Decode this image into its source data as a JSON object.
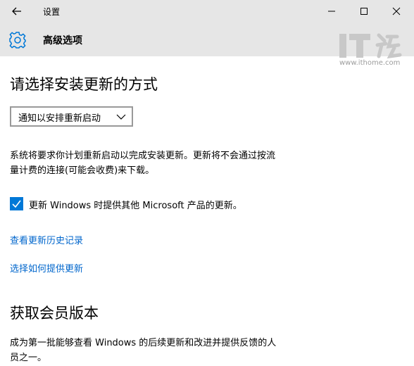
{
  "window": {
    "title": "设置"
  },
  "header": {
    "title": "高级选项",
    "logo_text": "IT之家",
    "logo_url": "www.ithome.com"
  },
  "install_section": {
    "heading": "请选择安装更新的方式",
    "dropdown_value": "通知以安排重新启动",
    "description_line1": "系统将要求你计划重新启动以完成安装更新。更新将不会通过按流",
    "description_line2": "量计费的连接(可能会收费)来下载。"
  },
  "checkbox": {
    "checked": true,
    "label": "更新 Windows 时提供其他 Microsoft 产品的更新。"
  },
  "links": {
    "history": "查看更新历史记录",
    "delivery": "选择如何提供更新"
  },
  "insider_section": {
    "heading": "获取会员版本",
    "description_line1": "成为第一批能够查看 Windows 的后续更新和改进并提供反馈的人",
    "description_line2": "员之一。"
  },
  "colors": {
    "accent": "#0078d7",
    "link": "#0066cc",
    "chrome": "#e6e6e6"
  }
}
